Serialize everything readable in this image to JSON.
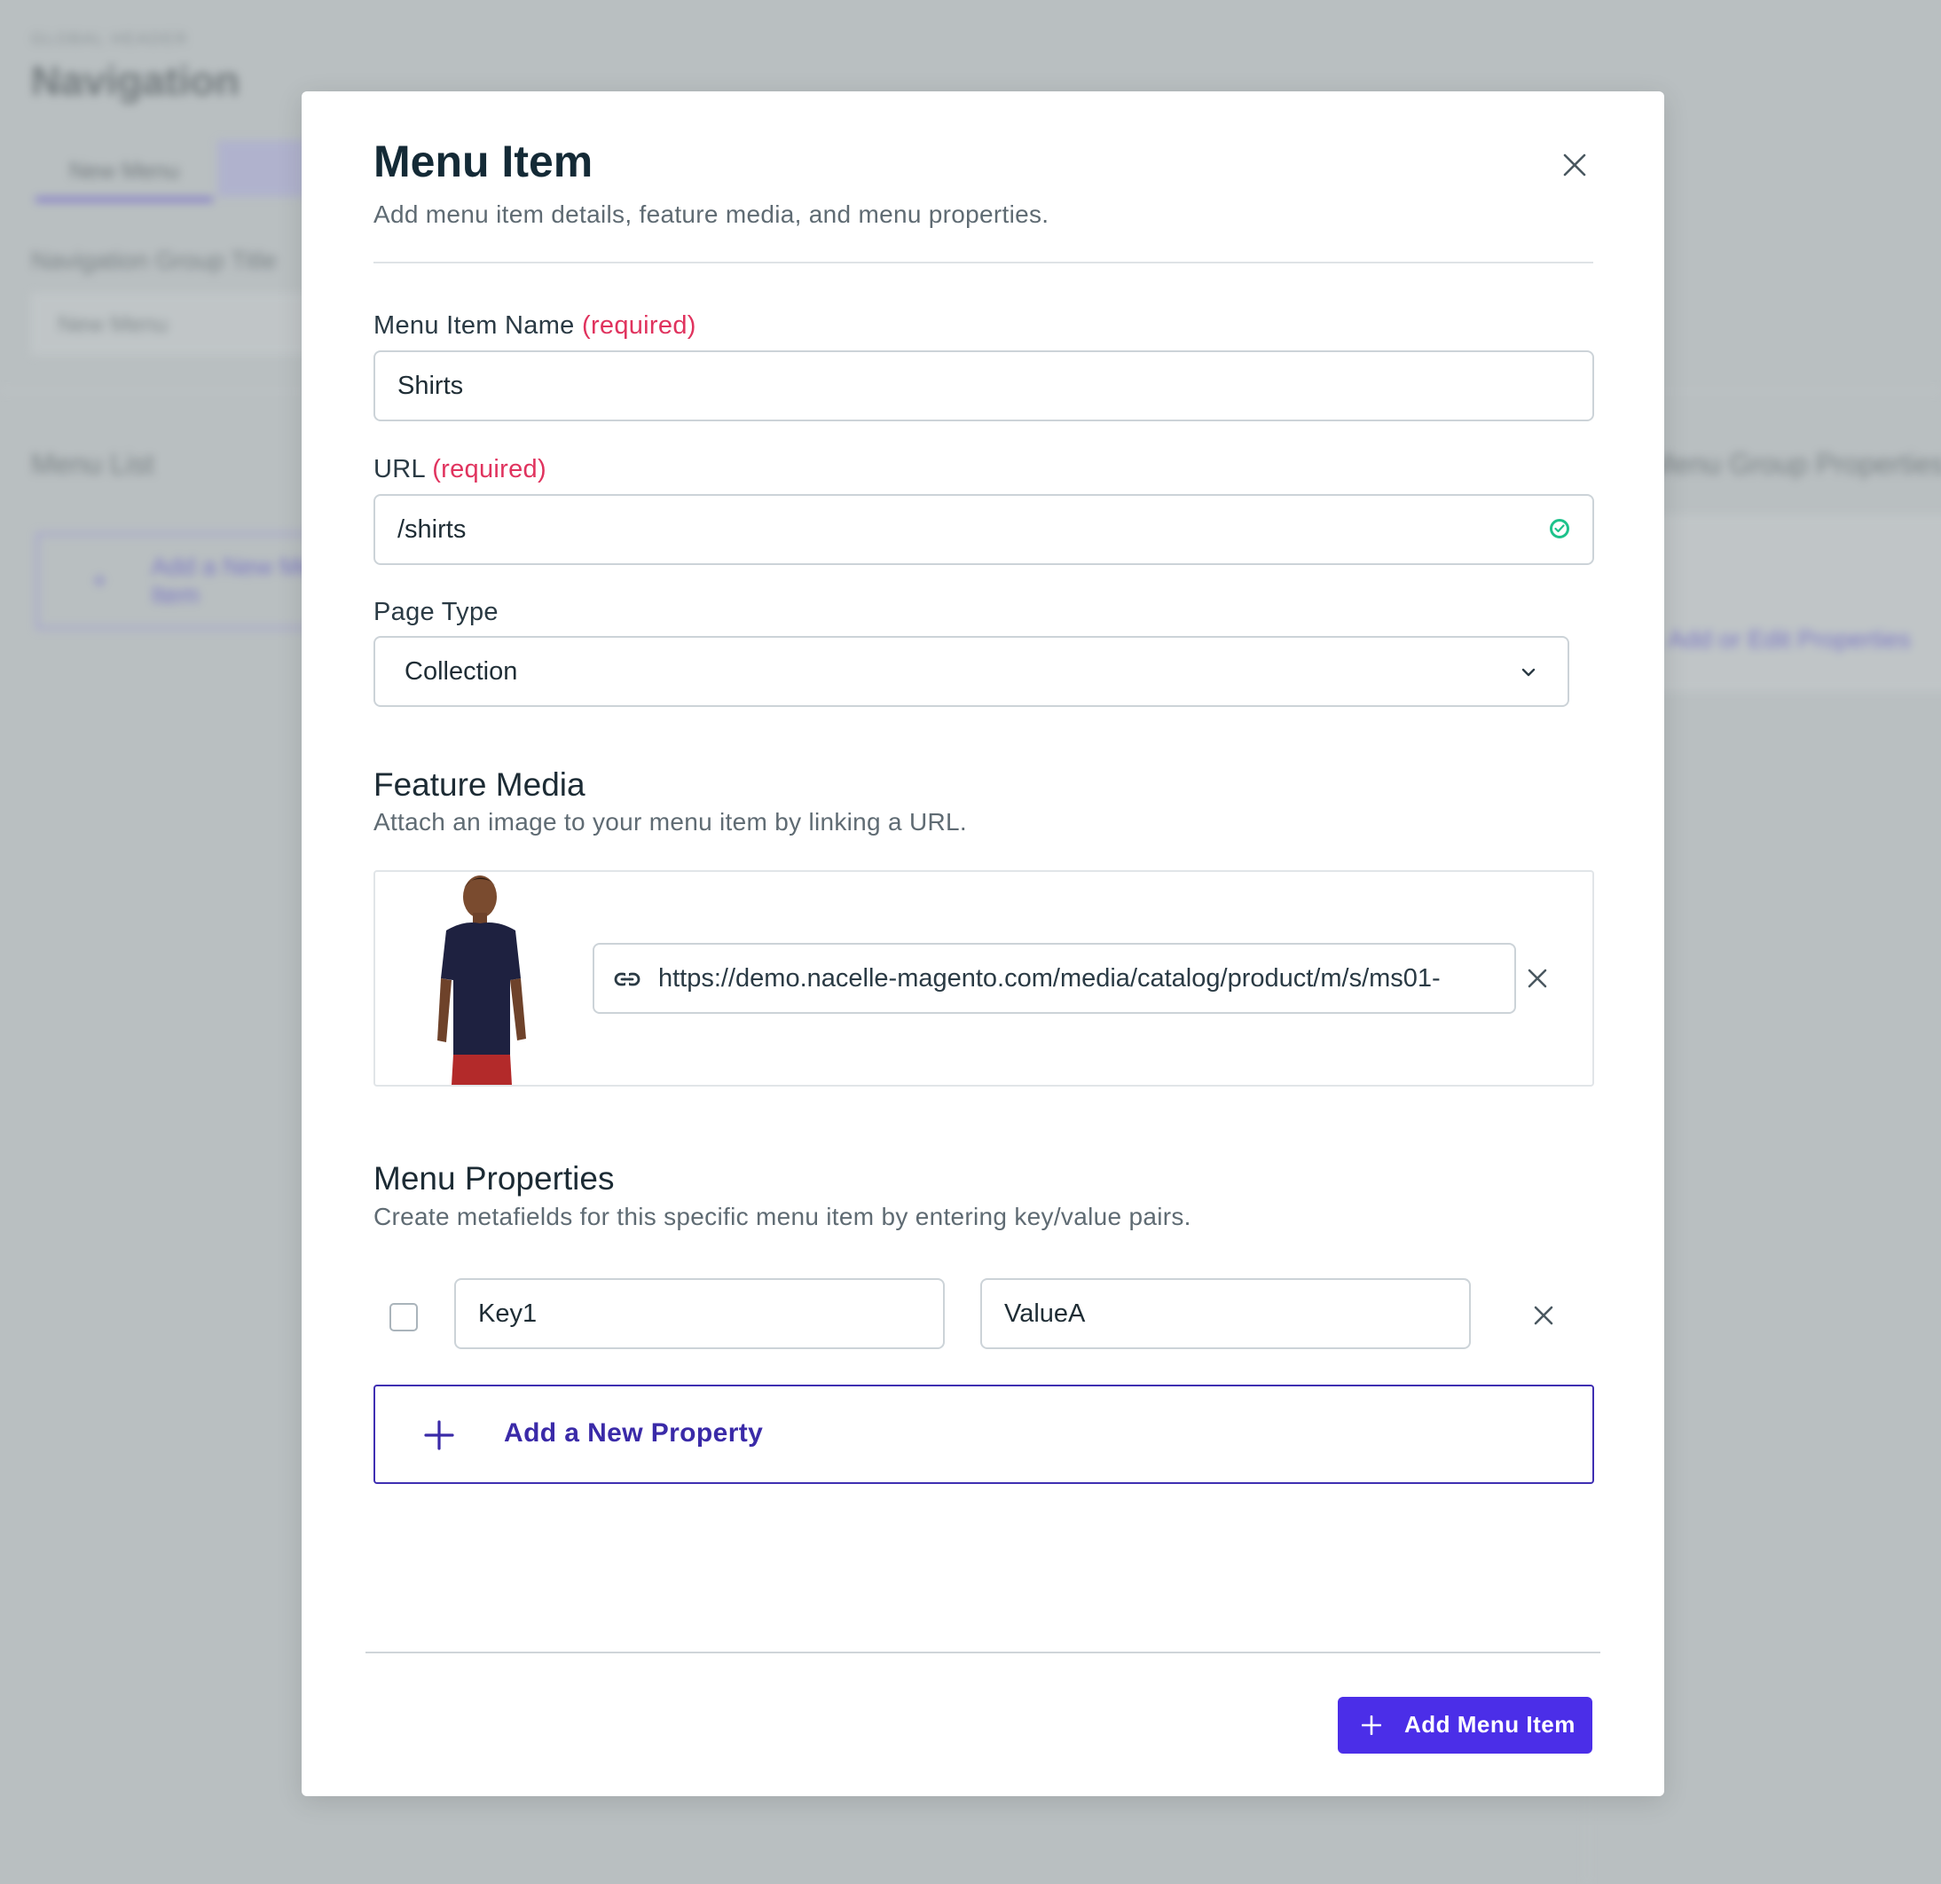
{
  "background": {
    "eyebrow": "GLOBAL HEADER",
    "page_title": "Navigation",
    "tab_label": "New Menu",
    "group_title_label": "Navigation Group Title",
    "group_title_value": "New Menu",
    "menu_list_heading": "Menu List",
    "add_menu_label": "Add a New Menu Item",
    "group_properties_heading": "Menu Group Properties",
    "add_edit_properties_label": "Add or Edit Properties"
  },
  "modal": {
    "title": "Menu Item",
    "subtitle": "Add menu item details, feature media, and menu properties.",
    "close_icon": "close-icon",
    "name_field": {
      "label": "Menu Item Name",
      "required_tag": "(required)",
      "value": "Shirts"
    },
    "url_field": {
      "label": "URL",
      "required_tag": "(required)",
      "value": "/shirts",
      "status_icon": "check-circle-icon"
    },
    "page_type": {
      "label": "Page Type",
      "selected": "Collection"
    },
    "feature_media": {
      "title": "Feature Media",
      "subtitle": "Attach an image to your menu item by linking a URL.",
      "image_url": "https://demo.nacelle-magento.com/media/catalog/product/m/s/ms01-"
    },
    "menu_properties": {
      "title": "Menu Properties",
      "subtitle": "Create metafields for this specific menu item by entering key/value pairs.",
      "rows": [
        {
          "key": "Key1",
          "value": "ValueA"
        }
      ],
      "add_label": "Add a New Property"
    },
    "submit_label": "Add Menu Item"
  },
  "colors": {
    "accent": "#4b2ee8",
    "accent_dark": "#3a2aa8",
    "required": "#e0335e",
    "success": "#1ec28b",
    "overlay": "#b9bfc1"
  }
}
